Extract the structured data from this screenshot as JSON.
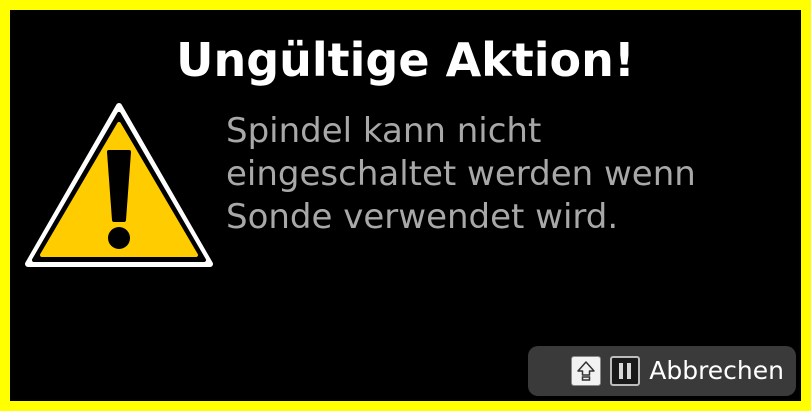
{
  "dialog": {
    "title": "Ungültige Aktion!",
    "message_lines": [
      "Spindel kann nicht",
      "eingeschaltet werden wenn",
      "Sonde verwendet wird."
    ],
    "icon": "warning-triangle-icon",
    "colors": {
      "border": "#ffff00",
      "background": "#000000",
      "title": "#ffffff",
      "message": "#a8a8a8",
      "warning_fill": "#ffcc00"
    }
  },
  "cancel_button": {
    "label": "Abbrechen",
    "icons": [
      "shift-key-icon",
      "pause-key-icon"
    ],
    "background": "#3a3a3a"
  }
}
